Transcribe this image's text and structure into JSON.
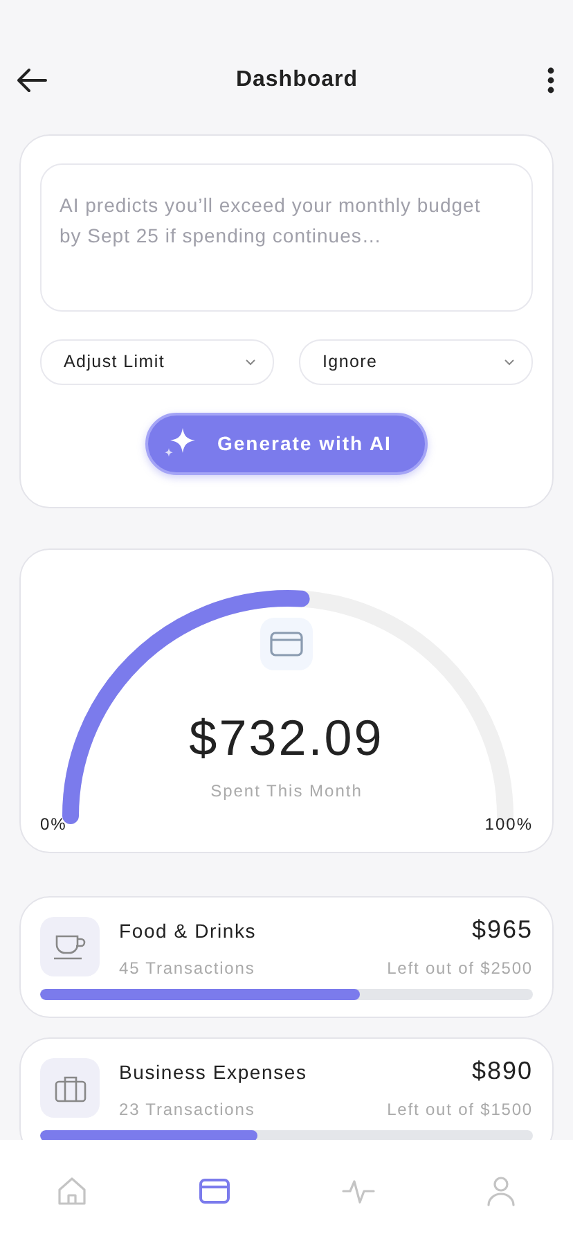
{
  "header": {
    "title": "Dashboard"
  },
  "ai_card": {
    "prompt": {
      "placeholder": "AI predicts you’ll exceed your monthly budget by Sept 25 if spending continues…"
    },
    "dropdowns": [
      {
        "value": "Adjust Limit"
      },
      {
        "value": "Ignore"
      }
    ],
    "button": "Generate with AI"
  },
  "gauge": {
    "amount": "$732.09",
    "caption": "Spent This Month",
    "min_label": "0%",
    "max_label": "100%"
  },
  "categories": [
    {
      "name": "Food & Drinks",
      "transactions": "45 Transactions",
      "amount": "$965",
      "limit": "Left out of $2500",
      "level": 0.65
    },
    {
      "name": "Business Expenses",
      "transactions": "23 Transactions",
      "amount": "$890",
      "limit": "Left out of $1500",
      "level": 0.44
    }
  ],
  "nav": [
    {
      "selected": false
    },
    {
      "selected": true
    },
    {
      "selected": false
    },
    {
      "selected": false
    }
  ]
}
